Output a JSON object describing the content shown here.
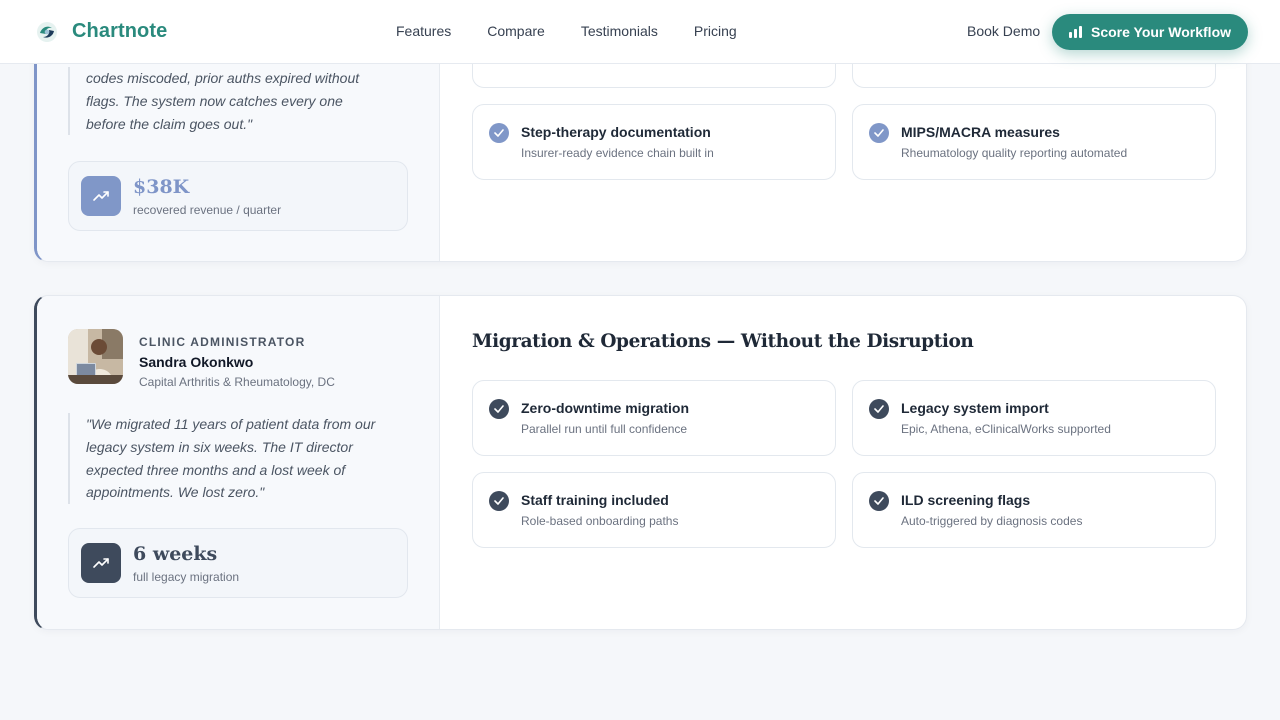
{
  "header": {
    "brand": "Chartnote",
    "nav": [
      "Features",
      "Compare",
      "Testimonials",
      "Pricing"
    ],
    "book_demo": "Book Demo",
    "cta": "Score Your Workflow"
  },
  "card1": {
    "quote": "codes miscoded, prior auths expired without flags. The system now catches every one before the claim goes out.\"",
    "stat_value": "$38K",
    "stat_label": "recovered revenue / quarter",
    "features": [
      {
        "title": "Step-therapy documentation",
        "desc": "Insurer-ready evidence chain built in"
      },
      {
        "title": "MIPS/MACRA measures",
        "desc": "Rheumatology quality reporting automated"
      }
    ]
  },
  "card2": {
    "role": "CLINIC ADMINISTRATOR",
    "name": "Sandra Okonkwo",
    "clinic": "Capital Arthritis & Rheumatology, DC",
    "quote": "\"We migrated 11 years of patient data from our legacy system in six weeks. The IT director expected three months and a lost week of appointments. We lost zero.\"",
    "stat_value": "6 weeks",
    "stat_label": "full legacy migration",
    "section_title": "Migration & Operations — Without the Disruption",
    "features": [
      {
        "title": "Zero-downtime migration",
        "desc": "Parallel run until full confidence"
      },
      {
        "title": "Legacy system import",
        "desc": "Epic, Athena, eClinicalWorks supported"
      },
      {
        "title": "Staff training included",
        "desc": "Role-based onboarding paths"
      },
      {
        "title": "ILD screening flags",
        "desc": "Auto-triggered by diagnosis codes"
      }
    ]
  },
  "colors": {
    "brand": "#2a8a7d",
    "accent_blue": "#7f95c8",
    "accent_slate": "#3e4a5c"
  },
  "icons": [
    "logo-mark",
    "bar-chart-icon",
    "trending-up-icon",
    "check-circle-icon"
  ]
}
